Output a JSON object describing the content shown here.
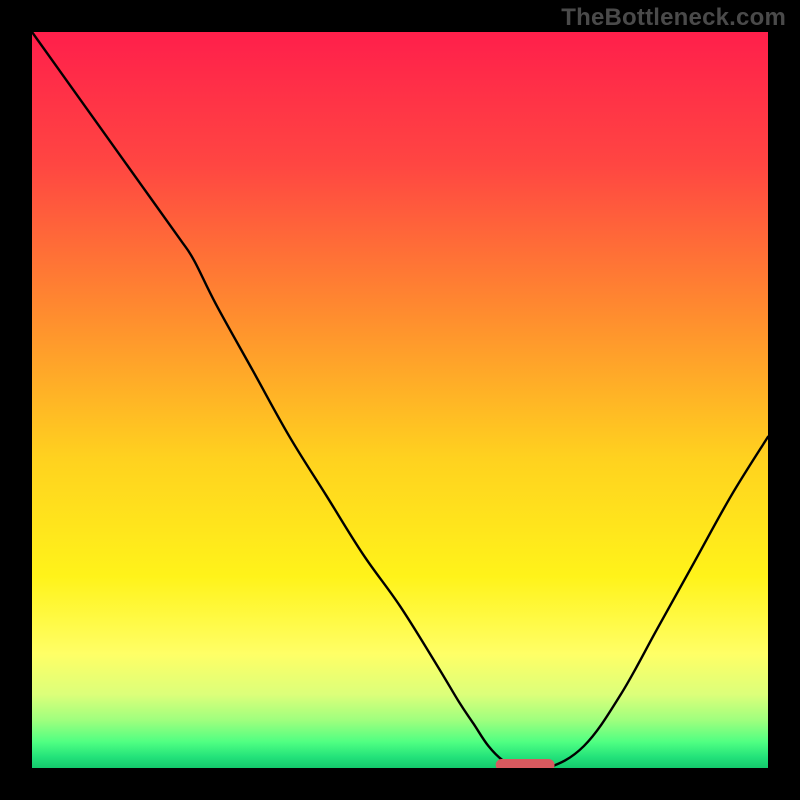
{
  "watermark": "TheBottleneck.com",
  "colors": {
    "frame_bg": "#000000",
    "curve": "#000000",
    "marker_fill": "#d85a5f",
    "gradient_stops": [
      {
        "offset": 0.0,
        "color": "#ff1f4b"
      },
      {
        "offset": 0.18,
        "color": "#ff4642"
      },
      {
        "offset": 0.38,
        "color": "#ff8b2f"
      },
      {
        "offset": 0.58,
        "color": "#ffd21f"
      },
      {
        "offset": 0.74,
        "color": "#fff31a"
      },
      {
        "offset": 0.845,
        "color": "#ffff66"
      },
      {
        "offset": 0.9,
        "color": "#dcff7a"
      },
      {
        "offset": 0.935,
        "color": "#9fff7e"
      },
      {
        "offset": 0.965,
        "color": "#4fff82"
      },
      {
        "offset": 0.985,
        "color": "#23e27a"
      },
      {
        "offset": 1.0,
        "color": "#14c96c"
      }
    ]
  },
  "chart_data": {
    "type": "line",
    "title": "",
    "xlabel": "",
    "ylabel": "",
    "xlim": [
      0,
      100
    ],
    "ylim": [
      0,
      100
    ],
    "x": [
      0,
      5,
      10,
      15,
      20,
      22,
      25,
      30,
      35,
      40,
      45,
      50,
      55,
      58,
      60,
      62,
      64,
      66,
      70,
      75,
      80,
      85,
      90,
      95,
      100
    ],
    "values": [
      100,
      93,
      86,
      79,
      72,
      69,
      63,
      54,
      45,
      37,
      29,
      22,
      14,
      9,
      6,
      3,
      1,
      0,
      0,
      3,
      10,
      19,
      28,
      37,
      45
    ],
    "marker": {
      "x_start": 63,
      "x_end": 71,
      "y": 0
    },
    "annotations": []
  }
}
